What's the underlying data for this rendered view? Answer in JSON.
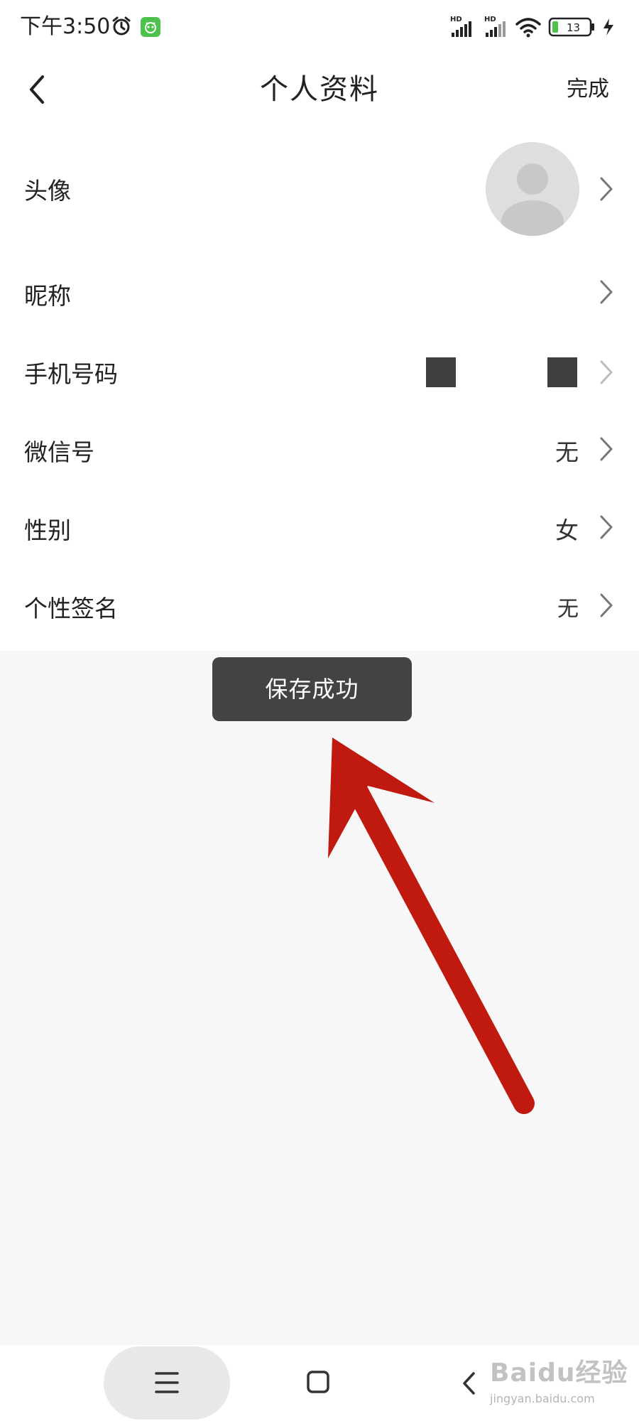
{
  "status_bar": {
    "time": "下午3:50",
    "network_1": "HD",
    "network_2": "HD",
    "battery": "13",
    "icons": [
      "alarm-icon",
      "app-notification-icon",
      "signal-icon",
      "wifi-icon",
      "battery-icon",
      "charging-icon"
    ]
  },
  "header": {
    "title": "个人资料",
    "done_label": "完成",
    "back_icon": "chevron-left-icon"
  },
  "profile": {
    "rows": [
      {
        "label": "头像",
        "value": ""
      },
      {
        "label": "昵称",
        "value": ""
      },
      {
        "label": "手机号码",
        "value": ""
      },
      {
        "label": "微信号",
        "value": "无"
      },
      {
        "label": "性别",
        "value": "女"
      },
      {
        "label": "个性签名",
        "value": "无"
      }
    ]
  },
  "toast": {
    "message": "保存成功"
  },
  "annotation": {
    "color": "#c0190f"
  },
  "nav_bar": {
    "icons": [
      "menu-icon",
      "home-icon",
      "back-icon"
    ]
  },
  "watermark": {
    "main": "Baidu经验",
    "sub": "jingyan.baidu.com"
  },
  "colors": {
    "background": "#f7f7f7",
    "surface": "#ffffff",
    "toast": "#434343",
    "app_badge": "#4cc24c"
  }
}
